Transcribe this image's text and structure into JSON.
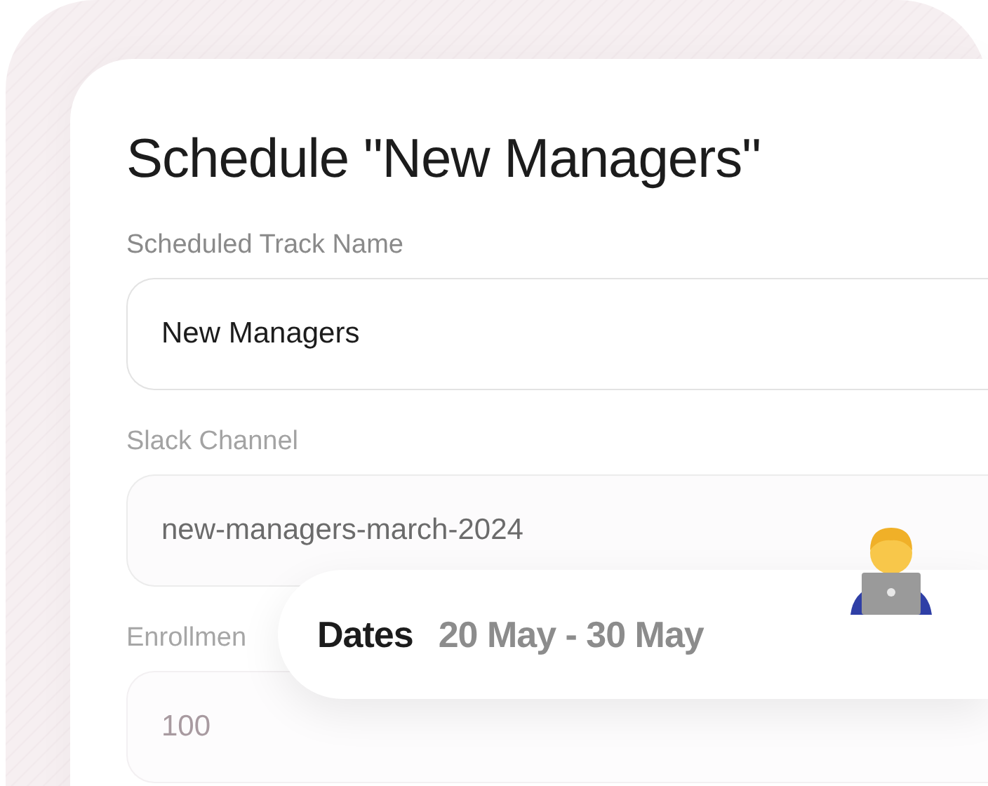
{
  "title": "Schedule \"New Managers\"",
  "fields": [
    {
      "label": "Scheduled Track Name",
      "value": "New Managers"
    },
    {
      "label": "Slack Channel",
      "value": "new-managers-march-2024"
    },
    {
      "label": "Enrollmen",
      "value": "100"
    }
  ],
  "dates": {
    "label": "Dates",
    "value": "20 May - 30 May"
  }
}
